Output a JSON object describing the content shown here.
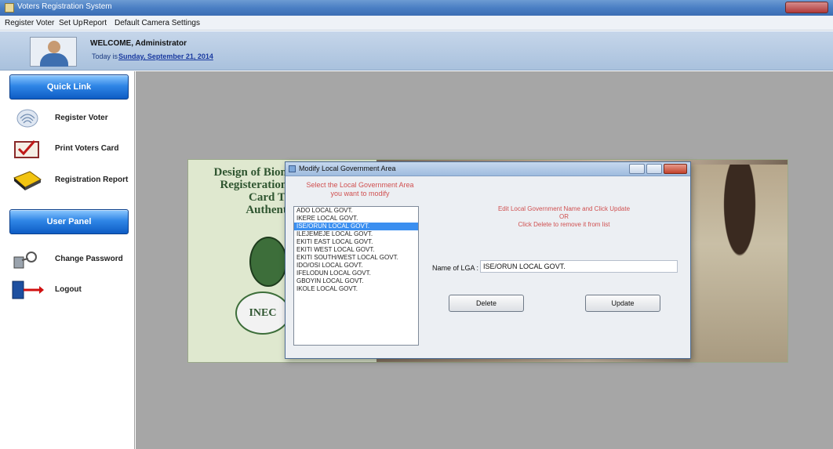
{
  "window": {
    "title": "Voters Registration System"
  },
  "menu": [
    "Register Voter",
    "Set Up",
    "Report",
    "Default Camera Settings"
  ],
  "header": {
    "welcome": "WELCOME, Administrator",
    "today_label": "Today is",
    "today_date": "Sunday, September 21, 2014"
  },
  "sidebar": {
    "quick_link": "Quick Link",
    "user_panel": "User Panel",
    "quick_items": [
      {
        "label": "Register Voter",
        "icon": "fingerprint-icon"
      },
      {
        "label": "Print Voters Card",
        "icon": "voters-card-icon"
      },
      {
        "label": "Registration Report",
        "icon": "book-icon"
      }
    ],
    "user_items": [
      {
        "label": "Change Password",
        "icon": "key-lock-icon"
      },
      {
        "label": "Logout",
        "icon": "logout-icon"
      }
    ]
  },
  "banner": {
    "title": "Design of Biom\nRegisteration \nCard To\nAuthenti",
    "inec": "INEC"
  },
  "dialog": {
    "title": "Modify Local Government Area",
    "instruction": "Select the Local Government Area you want to modify",
    "lga_list": [
      "ADO LOCAL GOVT.",
      "IKERE LOCAL GOVT.",
      "ISE/ORUN LOCAL GOVT.",
      "ILEJEMEJE LOCAL GOVT.",
      "EKITI EAST LOCAL GOVT.",
      "EKITI WEST LOCAL GOVT.",
      "EKITI SOUTH/WEST LOCAL GOVT.",
      "IDO/OSI LOCAL GOVT.",
      "IFELODUN LOCAL GOVT.",
      "GBOYIN LOCAL GOVT.",
      "IKOLE LOCAL GOVT."
    ],
    "selected_index": 2,
    "edit_hint_1": "Edit Local Government Name and Click Update",
    "edit_hint_or": "OR",
    "edit_hint_2": "Click Delete to remove it from list",
    "name_label": "Name of LGA :",
    "name_value": "ISE/ORUN LOCAL GOVT.",
    "delete_label": "Delete",
    "update_label": "Update"
  },
  "colors": {
    "accent": "#2f86e6",
    "hint_text": "#d05050",
    "workspace": "#a6a6a6"
  }
}
